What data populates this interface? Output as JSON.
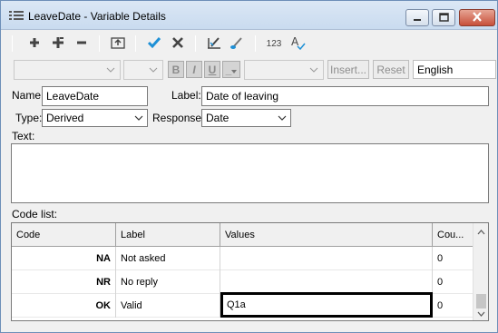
{
  "window": {
    "title": "LeaveDate - Variable Details"
  },
  "toolbar": {
    "buttons": [
      "add-icon",
      "insert-icon",
      "remove-icon",
      "level-up-icon",
      "accept-icon",
      "cancel-icon",
      "edit-label-icon",
      "brush-icon",
      "numbering-icon",
      "spellcheck-icon"
    ],
    "numbering_label": "123"
  },
  "format_bar": {
    "bold": "B",
    "italic": "I",
    "underline": "U",
    "extra": "_",
    "insert_label": "Insert...",
    "reset_label": "Reset",
    "language": "English"
  },
  "form": {
    "name_label": "Name:",
    "name_value": "LeaveDate",
    "label_label": "Label:",
    "label_value": "Date of leaving",
    "type_label": "Type:",
    "type_value": "Derived",
    "response_label": "Response:",
    "response_value": "Date",
    "text_label": "Text:",
    "codelist_label": "Code list:"
  },
  "grid": {
    "headers": [
      "Code",
      "Label",
      "Values",
      "Cou..."
    ],
    "rows": [
      {
        "code": "NA",
        "label": "Not asked",
        "values": "",
        "count": "0"
      },
      {
        "code": "NR",
        "label": "No reply",
        "values": "",
        "count": "0"
      },
      {
        "code": "OK",
        "label": "Valid",
        "values": "Q1a",
        "count": "0"
      }
    ]
  }
}
